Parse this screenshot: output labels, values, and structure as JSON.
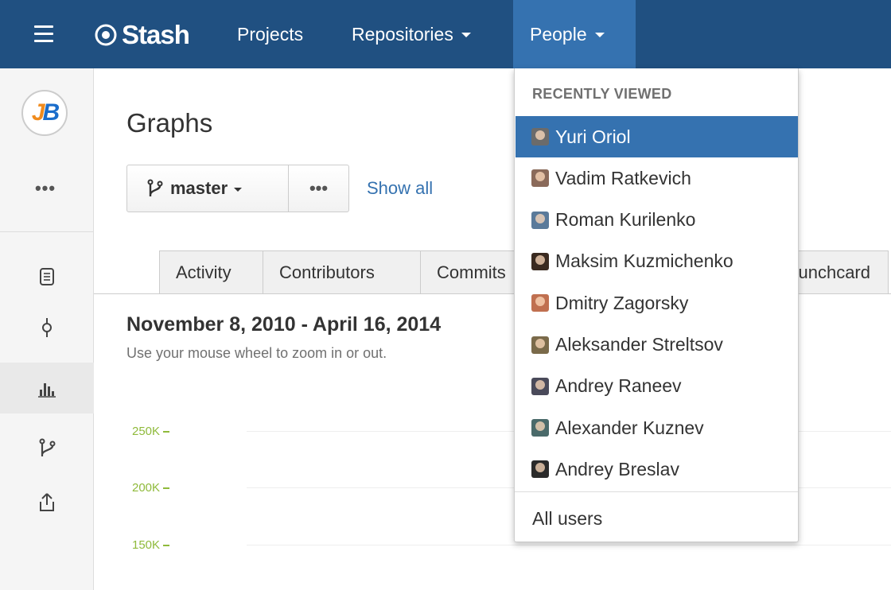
{
  "header": {
    "logo_text": "Stash",
    "nav": {
      "projects": "Projects",
      "repositories": "Repositories",
      "people": "People"
    }
  },
  "sidebar": {
    "project_avatar_letters": [
      "J",
      "B"
    ],
    "more": "•••",
    "icons": [
      "source-icon",
      "commits-icon",
      "graphs-icon",
      "branches-icon",
      "pull-request-icon"
    ],
    "active": "graphs-icon"
  },
  "main": {
    "title": "Graphs",
    "branch": "master",
    "more": "•••",
    "show_all": "Show all",
    "tabs": [
      {
        "label": "Activity"
      },
      {
        "label": "Contributors"
      },
      {
        "label": "Commits"
      },
      {
        "label": "Punchcard"
      }
    ],
    "range_title": "November 8, 2010 - April 16, 2014",
    "range_hint": "Use your mouse wheel to zoom in or out.",
    "y_ticks": [
      "250K",
      "200K",
      "150K"
    ]
  },
  "people_menu": {
    "heading": "RECENTLY VIEWED",
    "users": [
      {
        "name": "Yuri Oriol",
        "avatar_color": "#6b6b6b",
        "selected": true
      },
      {
        "name": "Vadim Ratkevich",
        "avatar_color": "#8a6a5a",
        "selected": false
      },
      {
        "name": "Roman Kurilenko",
        "avatar_color": "#5a7a9a",
        "selected": false
      },
      {
        "name": "Maksim Kuzmichenko",
        "avatar_color": "#3a2a20",
        "selected": false
      },
      {
        "name": "Dmitry Zagorsky",
        "avatar_color": "#c07050",
        "selected": false
      },
      {
        "name": "Aleksander Streltsov",
        "avatar_color": "#7a6a4a",
        "selected": false
      },
      {
        "name": "Andrey Raneev",
        "avatar_color": "#4a4a5a",
        "selected": false
      },
      {
        "name": "Alexander Kuznev",
        "avatar_color": "#4a6a6a",
        "selected": false
      },
      {
        "name": "Andrey Breslav",
        "avatar_color": "#2a2a2a",
        "selected": false
      }
    ],
    "all_users": "All users"
  },
  "colors": {
    "header_bg": "#205081",
    "active_nav": "#3572b0",
    "link": "#3572b0",
    "chart_green": "#8fba3b"
  }
}
